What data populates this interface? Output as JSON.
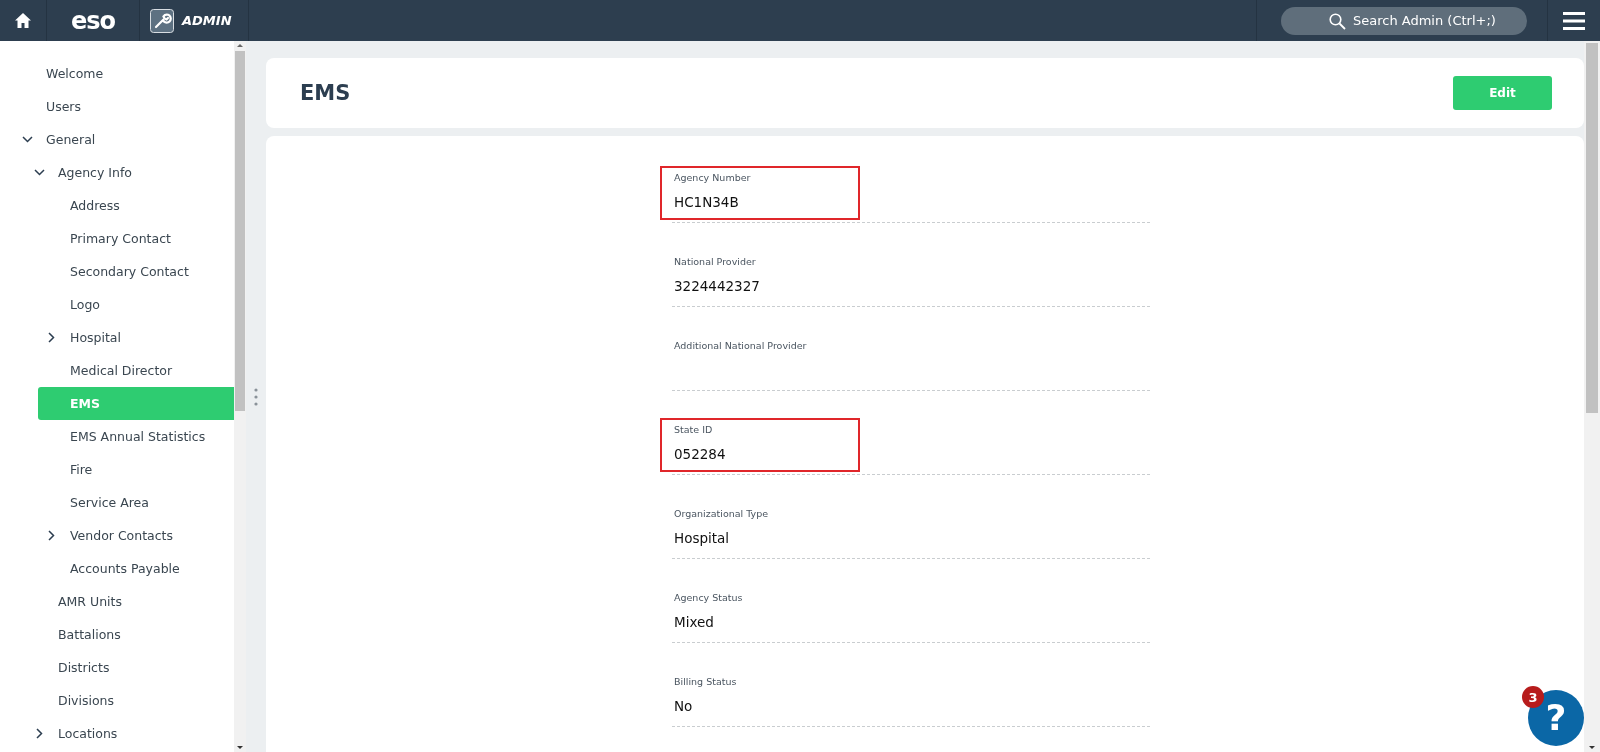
{
  "topbar": {
    "logo": "eso",
    "app_label": "ADMIN",
    "search": {
      "placeholder": "Search Admin (Ctrl+;)"
    }
  },
  "sidebar": {
    "items": [
      {
        "label": "Welcome",
        "selected": false
      },
      {
        "label": "Users",
        "selected": false
      },
      {
        "label": "General",
        "selected": false,
        "expanded": true,
        "children": [
          {
            "label": "Agency Info",
            "selected": false,
            "expanded": true,
            "children": [
              {
                "label": "Address",
                "selected": false
              },
              {
                "label": "Primary Contact",
                "selected": false
              },
              {
                "label": "Secondary Contact",
                "selected": false
              },
              {
                "label": "Logo",
                "selected": false
              },
              {
                "label": "Hospital",
                "selected": false,
                "expanded": false
              },
              {
                "label": "Medical Director",
                "selected": false
              },
              {
                "label": "EMS",
                "selected": true
              },
              {
                "label": "EMS Annual Statistics",
                "selected": false
              },
              {
                "label": "Fire",
                "selected": false
              },
              {
                "label": "Service Area",
                "selected": false
              },
              {
                "label": "Vendor Contacts",
                "selected": false,
                "expanded": false
              },
              {
                "label": "Accounts Payable",
                "selected": false
              }
            ]
          },
          {
            "label": "AMR Units",
            "selected": false
          },
          {
            "label": "Battalions",
            "selected": false
          },
          {
            "label": "Districts",
            "selected": false
          },
          {
            "label": "Divisions",
            "selected": false
          },
          {
            "label": "Locations",
            "selected": false,
            "expanded": false
          }
        ]
      }
    ]
  },
  "page": {
    "title": "EMS",
    "edit_button": "Edit"
  },
  "fields": [
    {
      "label": "Agency Number",
      "value": "HC1N34B",
      "highlighted": true
    },
    {
      "label": "National Provider",
      "value": "3224442327",
      "highlighted": false
    },
    {
      "label": "Additional National Provider",
      "highlighted": false
    },
    {
      "label": "State ID",
      "value": "052284",
      "highlighted": true
    },
    {
      "label": "Organizational Type",
      "value": "Hospital",
      "highlighted": false
    },
    {
      "label": "Agency Status",
      "value": "Mixed",
      "highlighted": false
    },
    {
      "label": "Billing Status",
      "value": "No",
      "highlighted": false
    }
  ],
  "help": {
    "badge": "3",
    "label": "?"
  }
}
